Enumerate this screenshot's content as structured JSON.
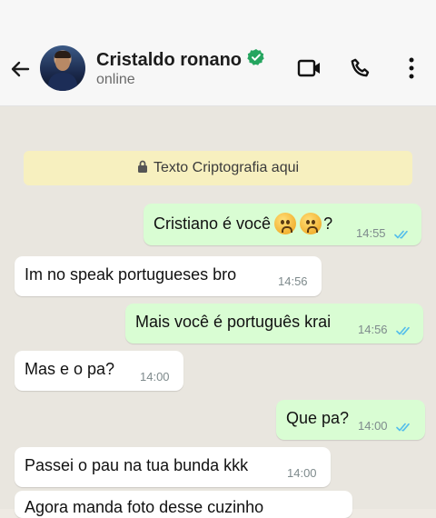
{
  "header": {
    "contact_name": "Cristaldo ronano",
    "status": "online",
    "icons": [
      "back-arrow-icon",
      "verified-icon",
      "video-call-icon",
      "phone-call-icon",
      "more-options-icon"
    ]
  },
  "encryption_notice": "Texto Criptografia aqui",
  "messages": [
    {
      "text": "Cristiano é você",
      "suffix": "?",
      "time": "14:55",
      "direction": "outgoing",
      "read": true
    },
    {
      "text": "Im no speak portugueses bro",
      "time": "14:56",
      "direction": "incoming"
    },
    {
      "text": "Mais você é português krai",
      "time": "14:56",
      "direction": "outgoing",
      "read": true
    },
    {
      "text": "Mas e o pa?",
      "time": "14:00",
      "direction": "incoming"
    },
    {
      "text": "Que pa?",
      "time": "14:00",
      "direction": "outgoing",
      "read": true
    },
    {
      "text": "Passei o pau na tua bunda kkk",
      "time": "14:00",
      "direction": "incoming"
    },
    {
      "text": "Agora manda foto desse cuzinho",
      "direction": "incoming"
    }
  ],
  "colors": {
    "outgoing_bubble": "#d9fdd3",
    "incoming_bubble": "#ffffff",
    "read_ticks": "#53bdeb",
    "verified_badge": "#25a55f",
    "encryption_banner": "#f7f0bf"
  }
}
